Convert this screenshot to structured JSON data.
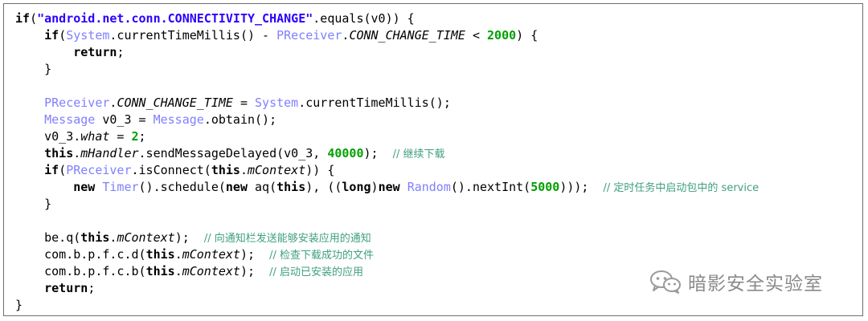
{
  "code": {
    "lines": [
      [
        [
          "kw",
          "if"
        ],
        [
          "p",
          "("
        ],
        [
          "str",
          "\"android.net.conn.CONNECTIVITY_CHANGE\""
        ],
        [
          "p",
          ".equals(v0)) {"
        ]
      ],
      [
        [
          "p",
          "    "
        ],
        [
          "kw",
          "if"
        ],
        [
          "p",
          "("
        ],
        [
          "cls",
          "System"
        ],
        [
          "p",
          ".currentTimeMillis() - "
        ],
        [
          "cls",
          "PReceiver"
        ],
        [
          "p",
          "."
        ],
        [
          "it",
          "CONN_CHANGE_TIME"
        ],
        [
          "p",
          " < "
        ],
        [
          "num",
          "2000"
        ],
        [
          "p",
          ") {"
        ]
      ],
      [
        [
          "p",
          "        "
        ],
        [
          "kw",
          "return"
        ],
        [
          "p",
          ";"
        ]
      ],
      [
        [
          "p",
          "    }"
        ]
      ],
      [
        [
          "p",
          ""
        ]
      ],
      [
        [
          "p",
          "    "
        ],
        [
          "cls",
          "PReceiver"
        ],
        [
          "p",
          "."
        ],
        [
          "it",
          "CONN_CHANGE_TIME"
        ],
        [
          "p",
          " = "
        ],
        [
          "cls",
          "System"
        ],
        [
          "p",
          ".currentTimeMillis();"
        ]
      ],
      [
        [
          "p",
          "    "
        ],
        [
          "cls",
          "Message"
        ],
        [
          "p",
          " v0_3 = "
        ],
        [
          "cls",
          "Message"
        ],
        [
          "p",
          ".obtain();"
        ]
      ],
      [
        [
          "p",
          "    v0_3."
        ],
        [
          "it",
          "what"
        ],
        [
          "p",
          " = "
        ],
        [
          "num",
          "2"
        ],
        [
          "p",
          ";"
        ]
      ],
      [
        [
          "p",
          "    "
        ],
        [
          "kw",
          "this"
        ],
        [
          "p",
          "."
        ],
        [
          "it",
          "mHandler"
        ],
        [
          "p",
          ".sendMessageDelayed(v0_3, "
        ],
        [
          "num",
          "40000"
        ],
        [
          "p",
          ");  "
        ],
        [
          "cm",
          "// 继续下载"
        ]
      ],
      [
        [
          "p",
          "    "
        ],
        [
          "kw",
          "if"
        ],
        [
          "p",
          "("
        ],
        [
          "cls",
          "PReceiver"
        ],
        [
          "p",
          ".isConnect("
        ],
        [
          "kw",
          "this"
        ],
        [
          "p",
          "."
        ],
        [
          "it",
          "mContext"
        ],
        [
          "p",
          ")) {"
        ]
      ],
      [
        [
          "p",
          "        "
        ],
        [
          "kw",
          "new"
        ],
        [
          "p",
          " "
        ],
        [
          "cls",
          "Timer"
        ],
        [
          "p",
          "().schedule("
        ],
        [
          "kw",
          "new"
        ],
        [
          "p",
          " aq("
        ],
        [
          "kw",
          "this"
        ],
        [
          "p",
          "), (("
        ],
        [
          "kw",
          "long"
        ],
        [
          "p",
          ")"
        ],
        [
          "kw",
          "new"
        ],
        [
          "p",
          " "
        ],
        [
          "cls",
          "Random"
        ],
        [
          "p",
          "().nextInt("
        ],
        [
          "num",
          "5000"
        ],
        [
          "p",
          ")));  "
        ],
        [
          "cm",
          "// 定时任务中启动包中的 service"
        ]
      ],
      [
        [
          "p",
          "    }"
        ]
      ],
      [
        [
          "p",
          ""
        ]
      ],
      [
        [
          "p",
          "    be.q("
        ],
        [
          "kw",
          "this"
        ],
        [
          "p",
          "."
        ],
        [
          "it",
          "mContext"
        ],
        [
          "p",
          ");  "
        ],
        [
          "cm",
          "// 向通知栏发送能够安装应用的通知"
        ]
      ],
      [
        [
          "p",
          "    com.b.p.f.c.d("
        ],
        [
          "kw",
          "this"
        ],
        [
          "p",
          "."
        ],
        [
          "it",
          "mContext"
        ],
        [
          "p",
          ");  "
        ],
        [
          "cm",
          "// 检查下载成功的文件"
        ]
      ],
      [
        [
          "p",
          "    com.b.p.f.c.b("
        ],
        [
          "kw",
          "this"
        ],
        [
          "p",
          "."
        ],
        [
          "it",
          "mContext"
        ],
        [
          "p",
          ");  "
        ],
        [
          "cm",
          "// 启动已安装的应用"
        ]
      ],
      [
        [
          "p",
          "    "
        ],
        [
          "kw",
          "return"
        ],
        [
          "p",
          ";"
        ]
      ],
      [
        [
          "p",
          "}"
        ]
      ]
    ]
  },
  "watermark": {
    "text": "暗影安全实验室",
    "icon": "wechat-icon",
    "color": "#8a8a8a"
  }
}
